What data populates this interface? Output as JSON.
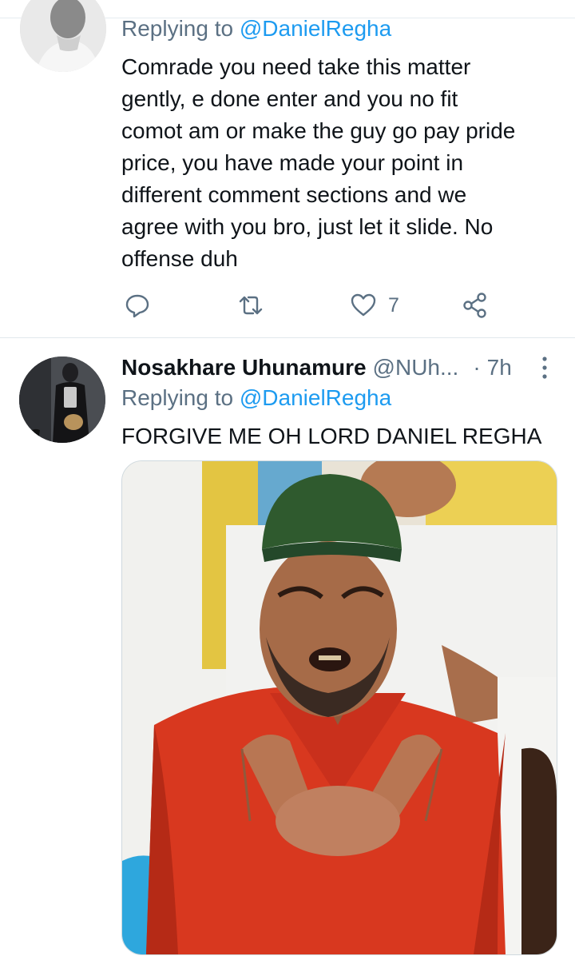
{
  "tweet1": {
    "replying_prefix": "Replying to ",
    "replying_handle": "@DanielRegha",
    "body_lines": [
      "Comrade you need take this matter",
      "gently, e done enter and you no fit",
      "comot am or make the guy go pay pride",
      "price, you have made your point in",
      "different comment sections and we",
      "agree with you bro, just let it slide. No",
      "offense duh"
    ],
    "like_count": "7"
  },
  "tweet2": {
    "name": "Nosakhare Uhunamure",
    "handle": "@NUh...",
    "separator": "·",
    "time": "7h",
    "replying_prefix": "Replying to ",
    "replying_handle": "@DanielRegha",
    "body": "FORGIVE ME OH LORD DANIEL REGHA"
  },
  "colors": {
    "accent": "#1d9bf0",
    "secondary_text": "#5b7083",
    "primary_text": "#0f1419"
  },
  "icons": {
    "reply": "reply-icon",
    "retweet": "retweet-icon",
    "like": "heart-icon",
    "share": "share-icon",
    "more": "more-vertical-icon"
  }
}
